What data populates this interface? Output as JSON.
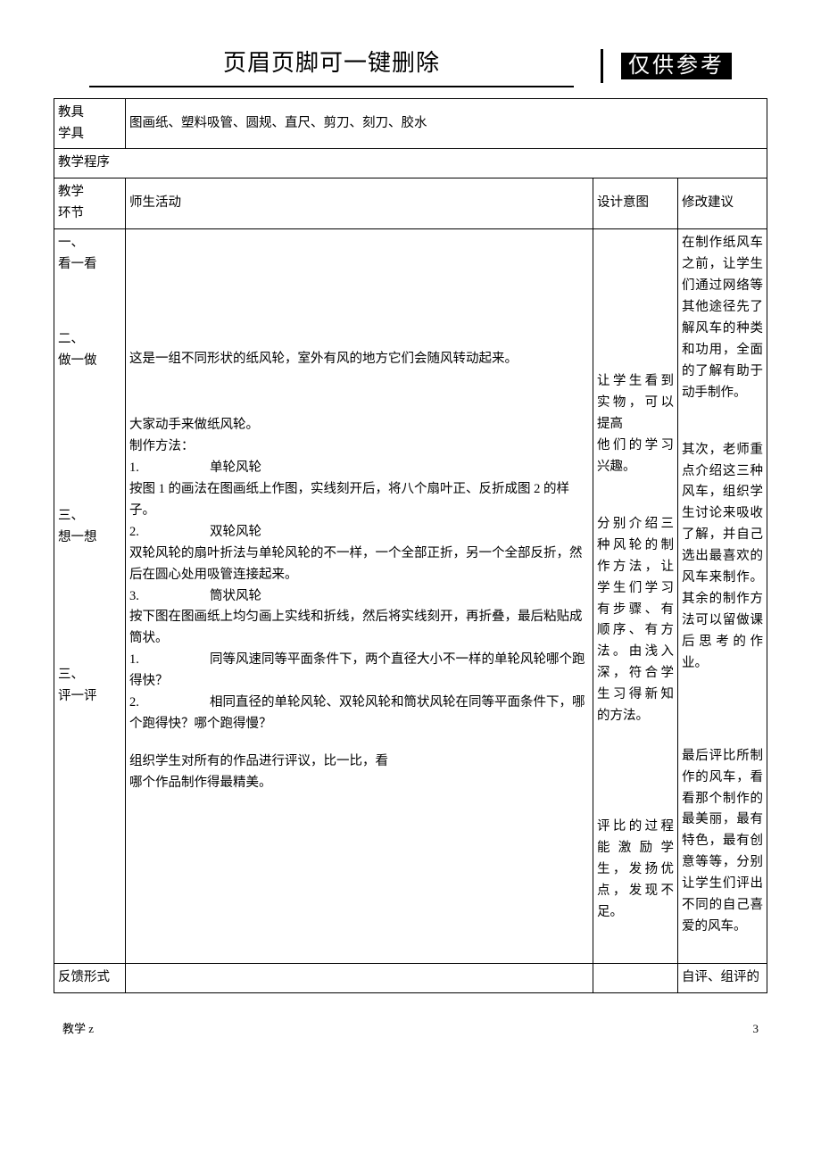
{
  "header": {
    "title": "页眉页脚可一键删除",
    "badge": "仅供参考"
  },
  "rows": {
    "tools": {
      "label": "教具\n学具",
      "content": "图画纸、塑料吸管、圆规、直尺、剪刀、刻刀、胶水"
    },
    "program": {
      "label": "教学程序"
    },
    "headers": {
      "stage": "教学\n环节",
      "activity": "师生活动",
      "intent": "设计意图",
      "suggestion": "修改建议"
    },
    "stages": {
      "s1": "一、\n看一看",
      "s2": "二、\n做一做",
      "s3": "三、\n想一想",
      "s4": "三、\n评一评"
    },
    "activities": {
      "a1": "这是一组不同形状的纸风轮，室外有风的地方它们会随风转动起来。",
      "a2_intro": "大家动手来做纸风轮。",
      "a2_method_label": "制作方法：",
      "a2_item1_num": "1.",
      "a2_item1_title": "单轮风轮",
      "a2_item1_body": "按图 1 的画法在图画纸上作图，实线刻开后，将八个扇叶正、反折成图 2 的样子。",
      "a2_item2_num": "2.",
      "a2_item2_title": "双轮风轮",
      "a2_item2_body": "双轮风轮的扇叶折法与单轮风轮的不一样，一个全部正折，另一个全部反折，然后在圆心处用吸管连接起来。",
      "a2_item3_num": "3.",
      "a2_item3_title": "筒状风轮",
      "a2_item3_body": "按下图在图画纸上均匀画上实线和折线，然后将实线刻开，再折叠，最后粘贴成筒状。",
      "a3_q1_num": "1.",
      "a3_q1": "同等风速同等平面条件下，两个直径大小不一样的单轮风轮哪个跑得快？",
      "a3_q2_num": "2.",
      "a3_q2": "相同直径的单轮风轮、双轮风轮和筒状风轮在同等平面条件下，哪个跑得快？哪个跑得慢？",
      "a4": "组织学生对所有的作品进行评议，比一比，看\n哪个作品制作得最精美。"
    },
    "intents": {
      "i1": "让学生看到实物，可以提高\n他们的学习兴趣。",
      "i2": "分别介绍三种风轮的制作方法，让学生们学习有步骤、有顺序、有方法。由浅入深，符合学生习得新知的方法。",
      "i3": "评比的过程能激励学生，发扬优点，发现不足。"
    },
    "suggestions": {
      "sg1": "在制作纸风车之前，让学生们通过网络等其他途径先了解风车的种类和功用，全面的了解有助于动手制作。",
      "sg2": "其次，老师重点介绍这三种风车，组织学生讨论来吸收了解，并自己选出最喜欢的风车来制作。其余的制作方法可以留做课后思考的作业。",
      "sg3": "最后评比所制作的风车，看看那个制作的最美丽，最有特色，最有创意等等，分别让学生们评出不同的自己喜爱的风车。"
    },
    "feedback": {
      "label": "反馈形式",
      "col4": "自评、组评的"
    }
  },
  "footer": {
    "left": "教学 z",
    "right": "3"
  }
}
